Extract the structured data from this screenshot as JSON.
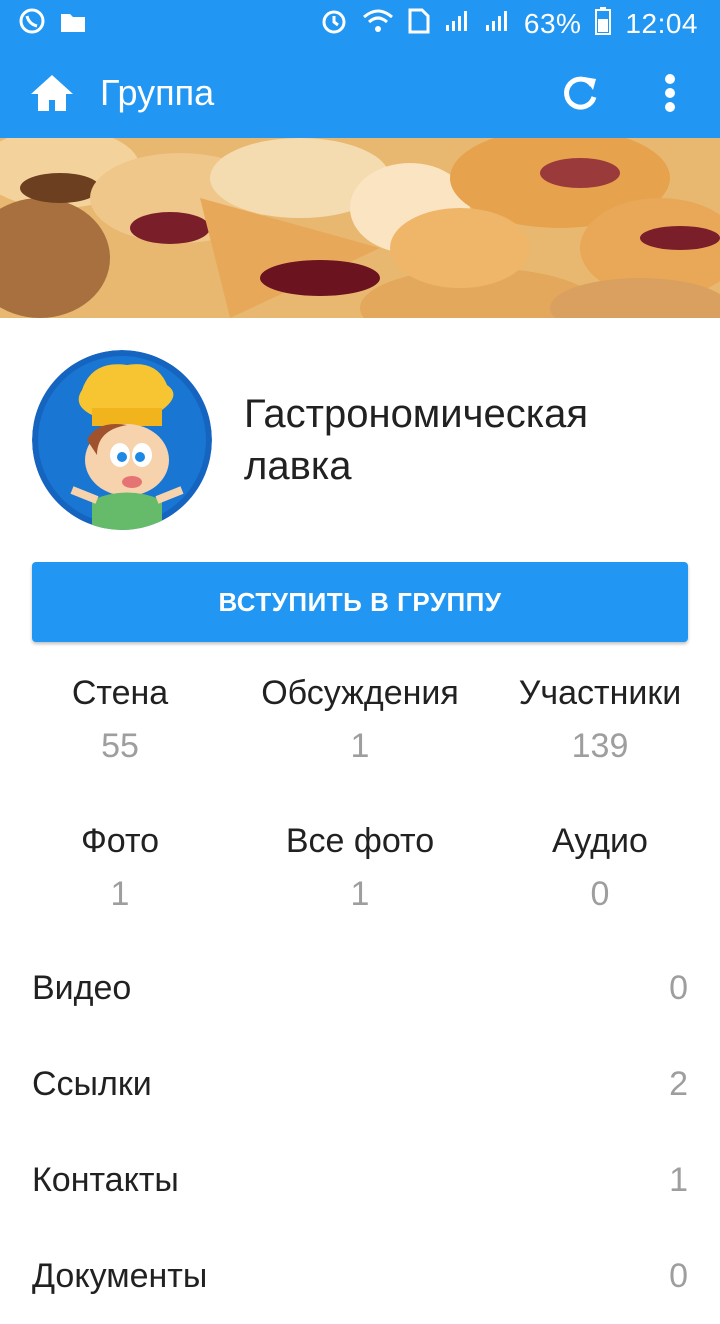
{
  "status_bar": {
    "battery": "63%",
    "time": "12:04",
    "icons": [
      "viber-icon",
      "folder-icon",
      "alarm-icon",
      "wifi-icon",
      "sim-icon",
      "signal-icon",
      "signal-icon",
      "battery-icon"
    ]
  },
  "app_bar": {
    "title": "Группа",
    "left_icon": "home-icon",
    "right_icons": [
      "refresh-icon",
      "more-vert-icon"
    ]
  },
  "group": {
    "name": "Гастрономическая лавка",
    "join_label": "ВСТУПИТЬ В ГРУППУ"
  },
  "stats": [
    {
      "label": "Стена",
      "value": "55"
    },
    {
      "label": "Обсуждения",
      "value": "1"
    },
    {
      "label": "Участники",
      "value": "139"
    },
    {
      "label": "Фото",
      "value": "1"
    },
    {
      "label": "Все фото",
      "value": "1"
    },
    {
      "label": "Аудио",
      "value": "0"
    }
  ],
  "list": [
    {
      "label": "Видео",
      "count": "0"
    },
    {
      "label": "Ссылки",
      "count": "2"
    },
    {
      "label": "Контакты",
      "count": "1"
    },
    {
      "label": "Документы",
      "count": "0"
    }
  ],
  "colors": {
    "accent": "#2196f3",
    "muted": "#9e9e9e",
    "text": "#212121"
  }
}
